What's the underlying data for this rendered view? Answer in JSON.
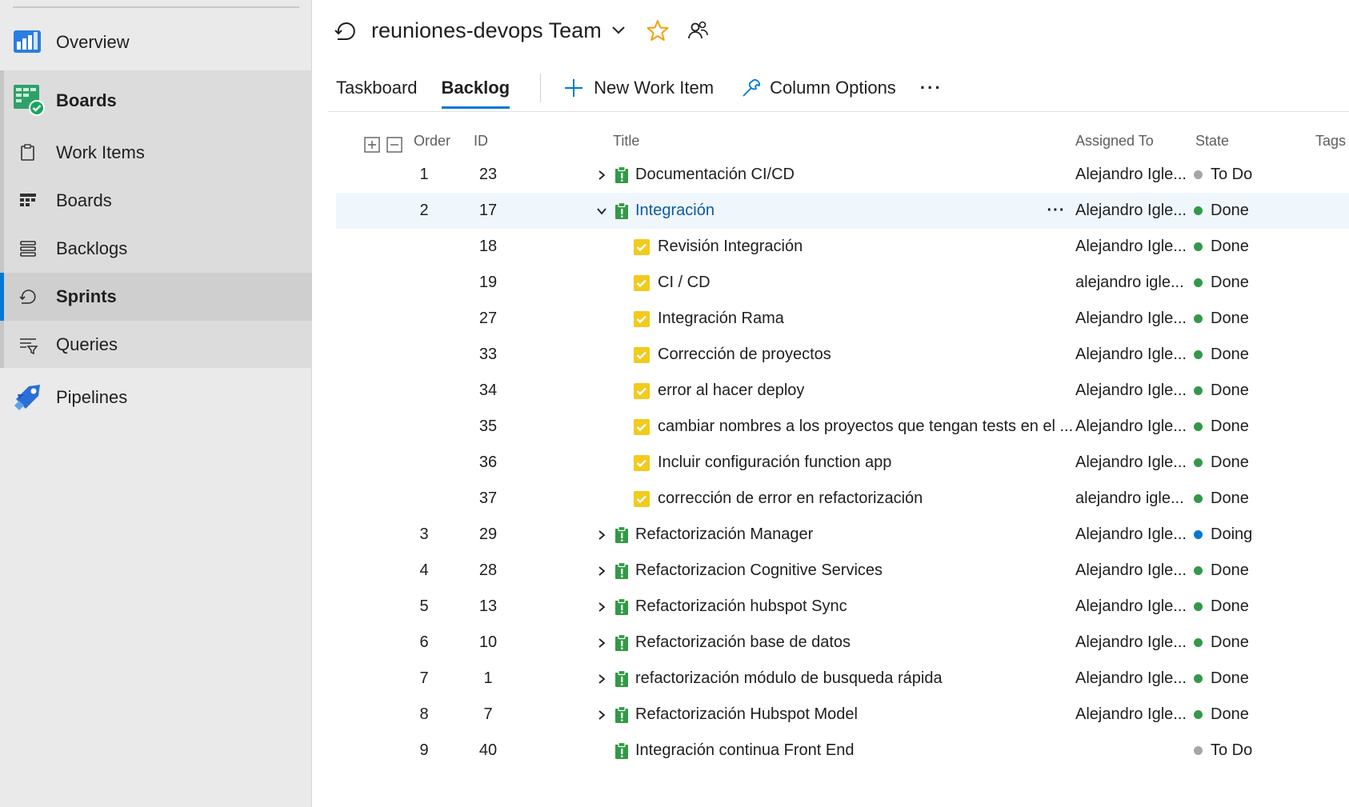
{
  "sidebar": {
    "items": [
      {
        "label": "Overview"
      },
      {
        "label": "Boards"
      },
      {
        "label": "Work Items"
      },
      {
        "label": "Boards"
      },
      {
        "label": "Backlogs"
      },
      {
        "label": "Sprints"
      },
      {
        "label": "Queries"
      },
      {
        "label": "Pipelines"
      }
    ]
  },
  "header": {
    "team_title": "reuniones-devops Team",
    "tabs": [
      {
        "label": "Taskboard"
      },
      {
        "label": "Backlog"
      }
    ],
    "new_work_item": "New Work Item",
    "column_options": "Column Options",
    "more": "···"
  },
  "grid": {
    "columns": {
      "order": "Order",
      "id": "ID",
      "title": "Title",
      "assigned": "Assigned To",
      "state": "State",
      "tags": "Tags"
    },
    "row_more": "···",
    "rows": [
      {
        "order": "1",
        "id": "23",
        "title": "Documentación CI/CD",
        "assigned": "Alejandro Igle...",
        "state": "To Do",
        "type": "pbi",
        "level": 0,
        "chevron": "collapsed"
      },
      {
        "order": "2",
        "id": "17",
        "title": "Integración",
        "assigned": "Alejandro Igle...",
        "state": "Done",
        "type": "pbi",
        "level": 0,
        "chevron": "expanded",
        "selected": true
      },
      {
        "order": "",
        "id": "18",
        "title": "Revisión Integración",
        "assigned": "Alejandro Igle...",
        "state": "Done",
        "type": "task",
        "level": 1
      },
      {
        "order": "",
        "id": "19",
        "title": "CI / CD",
        "assigned": "alejandro igle...",
        "state": "Done",
        "type": "task",
        "level": 1
      },
      {
        "order": "",
        "id": "27",
        "title": "Integración Rama",
        "assigned": "Alejandro Igle...",
        "state": "Done",
        "type": "task",
        "level": 1
      },
      {
        "order": "",
        "id": "33",
        "title": "Corrección de proyectos",
        "assigned": "Alejandro Igle...",
        "state": "Done",
        "type": "task",
        "level": 1
      },
      {
        "order": "",
        "id": "34",
        "title": "error al hacer deploy",
        "assigned": "Alejandro Igle...",
        "state": "Done",
        "type": "task",
        "level": 1
      },
      {
        "order": "",
        "id": "35",
        "title": "cambiar nombres a los proyectos que tengan tests en el ...",
        "assigned": "Alejandro Igle...",
        "state": "Done",
        "type": "task",
        "level": 1
      },
      {
        "order": "",
        "id": "36",
        "title": "Incluir configuración function app",
        "assigned": "Alejandro Igle...",
        "state": "Done",
        "type": "task",
        "level": 1
      },
      {
        "order": "",
        "id": "37",
        "title": "corrección de error en refactorización",
        "assigned": "alejandro igle...",
        "state": "Done",
        "type": "task",
        "level": 1
      },
      {
        "order": "3",
        "id": "29",
        "title": "Refactorización Manager",
        "assigned": "Alejandro Igle...",
        "state": "Doing",
        "type": "pbi",
        "level": 0,
        "chevron": "collapsed"
      },
      {
        "order": "4",
        "id": "28",
        "title": "Refactorizacion Cognitive Services",
        "assigned": "Alejandro Igle...",
        "state": "Done",
        "type": "pbi",
        "level": 0,
        "chevron": "collapsed"
      },
      {
        "order": "5",
        "id": "13",
        "title": "Refactorización hubspot Sync",
        "assigned": "Alejandro Igle...",
        "state": "Done",
        "type": "pbi",
        "level": 0,
        "chevron": "collapsed"
      },
      {
        "order": "6",
        "id": "10",
        "title": "Refactorización base de datos",
        "assigned": "Alejandro Igle...",
        "state": "Done",
        "type": "pbi",
        "level": 0,
        "chevron": "collapsed"
      },
      {
        "order": "7",
        "id": "1",
        "title": "refactorización módulo de busqueda rápida",
        "assigned": "Alejandro Igle...",
        "state": "Done",
        "type": "pbi",
        "level": 0,
        "chevron": "collapsed"
      },
      {
        "order": "8",
        "id": "7",
        "title": "Refactorización Hubspot Model",
        "assigned": "Alejandro Igle...",
        "state": "Done",
        "type": "pbi",
        "level": 0,
        "chevron": "collapsed"
      },
      {
        "order": "9",
        "id": "40",
        "title": "Integración continua Front End",
        "assigned": "",
        "state": "To Do",
        "type": "pbi",
        "level": 0,
        "chevron": "none"
      }
    ]
  },
  "colors": {
    "accent": "#0078d4",
    "state_todo": "#a6a6a6",
    "state_doing": "#0078d4",
    "state_done": "#339947",
    "pbi_icon": "#339947",
    "task_icon": "#f2cb1d",
    "star": "#f2a20d"
  },
  "icons": {
    "sprint": "sprint-icon",
    "star": "star-icon",
    "team_members": "team-members-icon",
    "expand_all": "expand-all-icon",
    "collapse_all": "collapse-all-icon",
    "new_item": "plus-icon",
    "column_options": "wrench-icon"
  }
}
